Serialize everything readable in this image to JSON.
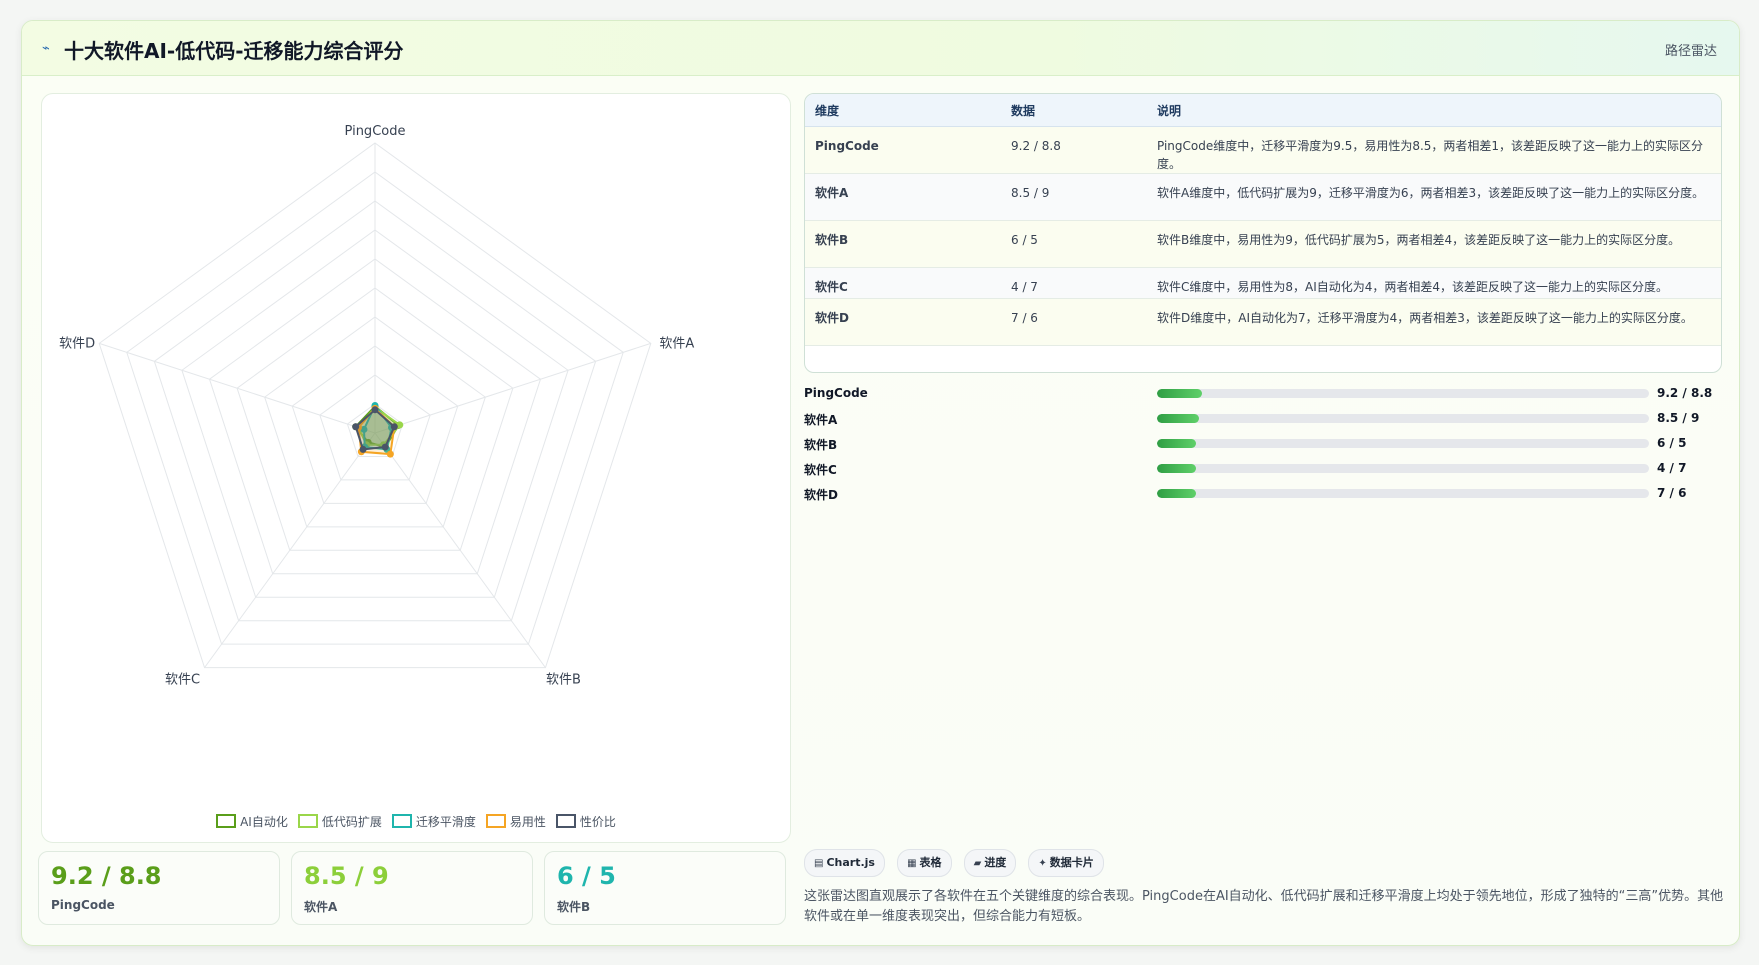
{
  "header": {
    "icon": "trend-icon",
    "title": "十大软件AI-低代码-迁移能力综合评分",
    "right_label": "路径雷达"
  },
  "chart_data": {
    "type": "radar",
    "axes": [
      "PingCode",
      "软件A",
      "软件B",
      "软件C",
      "软件D"
    ],
    "range": [
      0,
      100
    ],
    "grid_levels": 10,
    "legend_position": "bottom",
    "series": [
      {
        "name": "AI自动化",
        "color": "#5a9e1a",
        "values": [
          9.2,
          8.5,
          6,
          4,
          7
        ]
      },
      {
        "name": "低代码扩展",
        "color": "#9ad64a",
        "values": [
          8.8,
          9,
          5,
          5,
          6
        ]
      },
      {
        "name": "迁移平滑度",
        "color": "#1fb5ad",
        "values": [
          9.5,
          6,
          7,
          6,
          4
        ]
      },
      {
        "name": "易用性",
        "color": "#f5a524",
        "values": [
          8.5,
          7,
          9,
          8,
          6
        ]
      },
      {
        "name": "性价比",
        "color": "#4a5568",
        "values": [
          8,
          7,
          6,
          7,
          7
        ]
      }
    ]
  },
  "table": {
    "headers": [
      "维度",
      "数据",
      "说明"
    ],
    "rows": [
      {
        "name": "PingCode",
        "data": "9.2 / 8.8",
        "desc": "PingCode维度中，迁移平滑度为9.5，易用性为8.5，两者相差1，该差距反映了这一能力上的实际区分度。"
      },
      {
        "name": "软件A",
        "data": "8.5 / 9",
        "desc": "软件A维度中，低代码扩展为9，迁移平滑度为6，两者相差3，该差距反映了这一能力上的实际区分度。"
      },
      {
        "name": "软件B",
        "data": "6 / 5",
        "desc": "软件B维度中，易用性为9，低代码扩展为5，两者相差4，该差距反映了这一能力上的实际区分度。"
      },
      {
        "name": "软件C",
        "data": "4 / 7",
        "desc": "软件C维度中，易用性为8，AI自动化为4，两者相差4，该差距反映了这一能力上的实际区分度。"
      },
      {
        "name": "软件D",
        "data": "7 / 6",
        "desc": "软件D维度中，AI自动化为7，迁移平滑度为4，两者相差3，该差距反映了这一能力上的实际区分度。"
      }
    ]
  },
  "progress": [
    {
      "name": "PingCode",
      "value": "9.2 / 8.8",
      "fraction": 0.092
    },
    {
      "name": "软件A",
      "value": "8.5 / 9",
      "fraction": 0.085
    },
    {
      "name": "软件B",
      "value": "6 / 5",
      "fraction": 0.08
    },
    {
      "name": "软件C",
      "value": "4 / 7",
      "fraction": 0.08
    },
    {
      "name": "软件D",
      "value": "7 / 6",
      "fraction": 0.08
    }
  ],
  "stat_cards": [
    {
      "value": "9.2 / 8.8",
      "name": "PingCode",
      "color": "#5a9e1a"
    },
    {
      "value": "8.5 / 9",
      "name": "软件A",
      "color": "#8ccf3a"
    },
    {
      "value": "6 / 5",
      "name": "软件B",
      "color": "#1fb5ad"
    }
  ],
  "chips": [
    {
      "icon": "chart-icon",
      "label": "Chart.js"
    },
    {
      "icon": "table-icon",
      "label": "表格"
    },
    {
      "icon": "progress-icon",
      "label": "进度"
    },
    {
      "icon": "sparkle-icon",
      "label": "数据卡片"
    }
  ],
  "description": "这张雷达图直观展示了各软件在五个关键维度的综合表现。PingCode在AI自动化、低代码扩展和迁移平滑度上均处于领先地位，形成了独特的“三高”优势。其他软件或在单一维度表现突出，但综合能力有短板。"
}
